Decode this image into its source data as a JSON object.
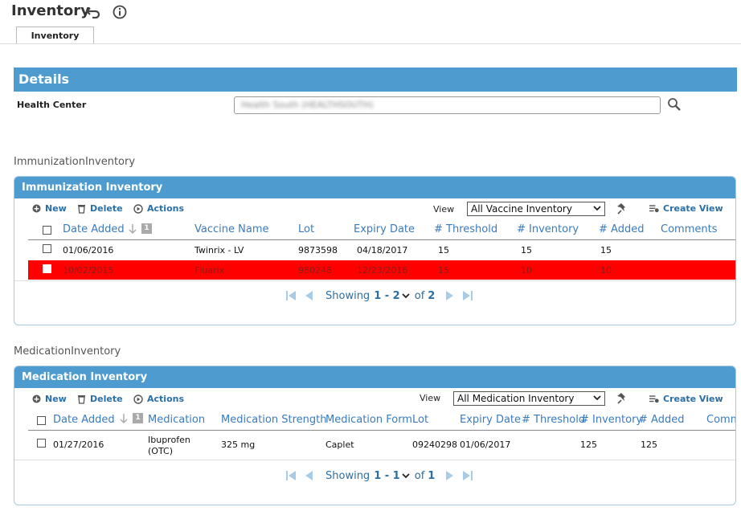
{
  "app": {
    "title": "Inventory",
    "tab_label": "Inventory"
  },
  "icons": {
    "back": "undo-arrow-icon",
    "info": "info-circle-icon",
    "search": "search-icon",
    "pin": "pin-icon"
  },
  "colors": {
    "accent": "#4d9bcf",
    "link": "#3a7bbf",
    "highlight_row": "#ff0000"
  },
  "details": {
    "title": "Details",
    "health_center_label": "Health Center",
    "health_center_value": "Health South (HEALTHSOUTH)"
  },
  "immunization": {
    "section_label": "ImmunizationInventory",
    "panel_title": "Immunization Inventory",
    "toolbar": {
      "new": "New",
      "delete": "Delete",
      "actions": "Actions",
      "view_label": "View",
      "view_value": "All Vaccine Inventory",
      "create_view": "Create View"
    },
    "sort_badge": "1",
    "columns": [
      "Date Added",
      "Vaccine Name",
      "Lot",
      "Expiry Date",
      "# Threshold",
      "# Inventory",
      "# Added",
      "Comments"
    ],
    "rows": [
      {
        "date_added": "01/06/2016",
        "vaccine_name": "Twinrix - LV",
        "lot": "9873598",
        "expiry": "04/18/2017",
        "threshold": "15",
        "inventory": "15",
        "added": "15",
        "comments": ""
      },
      {
        "date_added": "10/02/2015",
        "vaccine_name": "Fluarix",
        "lot": "980248",
        "expiry": "12/23/2016",
        "threshold": "15",
        "inventory": "10",
        "added": "10",
        "comments": ""
      }
    ],
    "pager": {
      "showing": "Showing",
      "range": "1 - 2",
      "of": "of",
      "total": "2"
    }
  },
  "medication": {
    "section_label": "MedicationInventory",
    "panel_title": "Medication Inventory",
    "toolbar": {
      "new": "New",
      "delete": "Delete",
      "actions": "Actions",
      "view_label": "View",
      "view_value": "All Medication Inventory",
      "create_view": "Create View"
    },
    "sort_badge": "1",
    "columns": [
      "Date Added",
      "Medication",
      "Medication Strength",
      "Medication Form",
      "Lot",
      "Expiry Date",
      "# Threshold",
      "# Inventory",
      "# Added",
      "Comments"
    ],
    "rows": [
      {
        "date_added": "01/27/2016",
        "medication_line1": "Ibuprofen",
        "medication_line2": "(OTC)",
        "strength": "325 mg",
        "form": "Caplet",
        "lot": "09240298",
        "expiry": "01/06/2017",
        "threshold": "",
        "inventory": "125",
        "added": "125",
        "comments": ""
      }
    ],
    "pager": {
      "showing": "Showing",
      "range": "1 - 1",
      "of": "of",
      "total": "1"
    }
  }
}
